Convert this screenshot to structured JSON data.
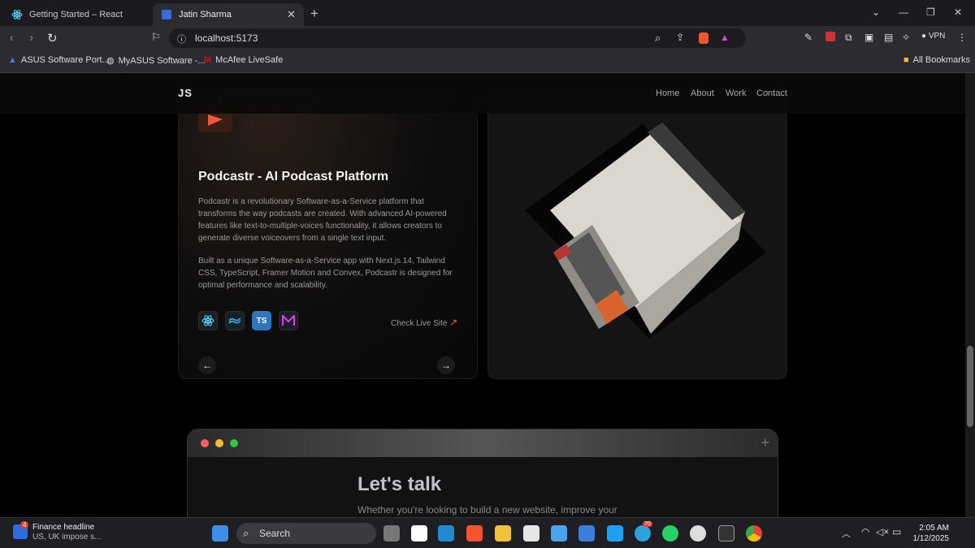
{
  "browser": {
    "tabs": [
      {
        "title": "Getting Started – React",
        "active": false
      },
      {
        "title": "Jatin Sharma",
        "active": true
      }
    ],
    "url": "localhost:5173",
    "vpn_label": "VPN",
    "bookmarks": [
      "ASUS Software Port...",
      "MyASUS Software -...",
      "McAfee LiveSafe"
    ],
    "all_bookmarks": "All Bookmarks"
  },
  "site": {
    "logo": "JS",
    "nav": [
      "Home",
      "About",
      "Work",
      "Contact"
    ]
  },
  "project": {
    "title": "Podcastr - AI Podcast Platform",
    "description_1": "Podcastr is a revolutionary Software-as-a-Service platform that transforms the way podcasts are created. With advanced AI-powered features like text-to-multiple-voices functionality, it allows creators to generate diverse voiceovers from a single text input.",
    "description_2": "Built as a unique Software-as-a-Service app with Next.js 14, Tailwind CSS, TypeScript, Framer Motion and Convex, Podcastr is designed for optimal performance and scalability.",
    "tech_icons": [
      "react-icon",
      "tailwind-icon",
      "typescript-icon",
      "framer-motion-icon"
    ],
    "ts_label": "TS",
    "live_link": "Check Live Site",
    "live_arrow": "↗",
    "prev": "←",
    "next": "→"
  },
  "contact": {
    "title": "Let's talk",
    "subtitle": "Whether you're looking to build a new website, improve your",
    "plus": "+"
  },
  "taskbar": {
    "badge": "4",
    "news_title": "Finance headline",
    "news_sub": "US, UK impose s...",
    "search": "Search",
    "telegram_badge": "70",
    "time": "2:05 AM",
    "date": "1/12/2025"
  },
  "colors": {
    "accent_red": "#ff5f57",
    "accent_yellow": "#febc2e",
    "accent_green": "#28c840",
    "brave_orange": "#fb542b"
  }
}
